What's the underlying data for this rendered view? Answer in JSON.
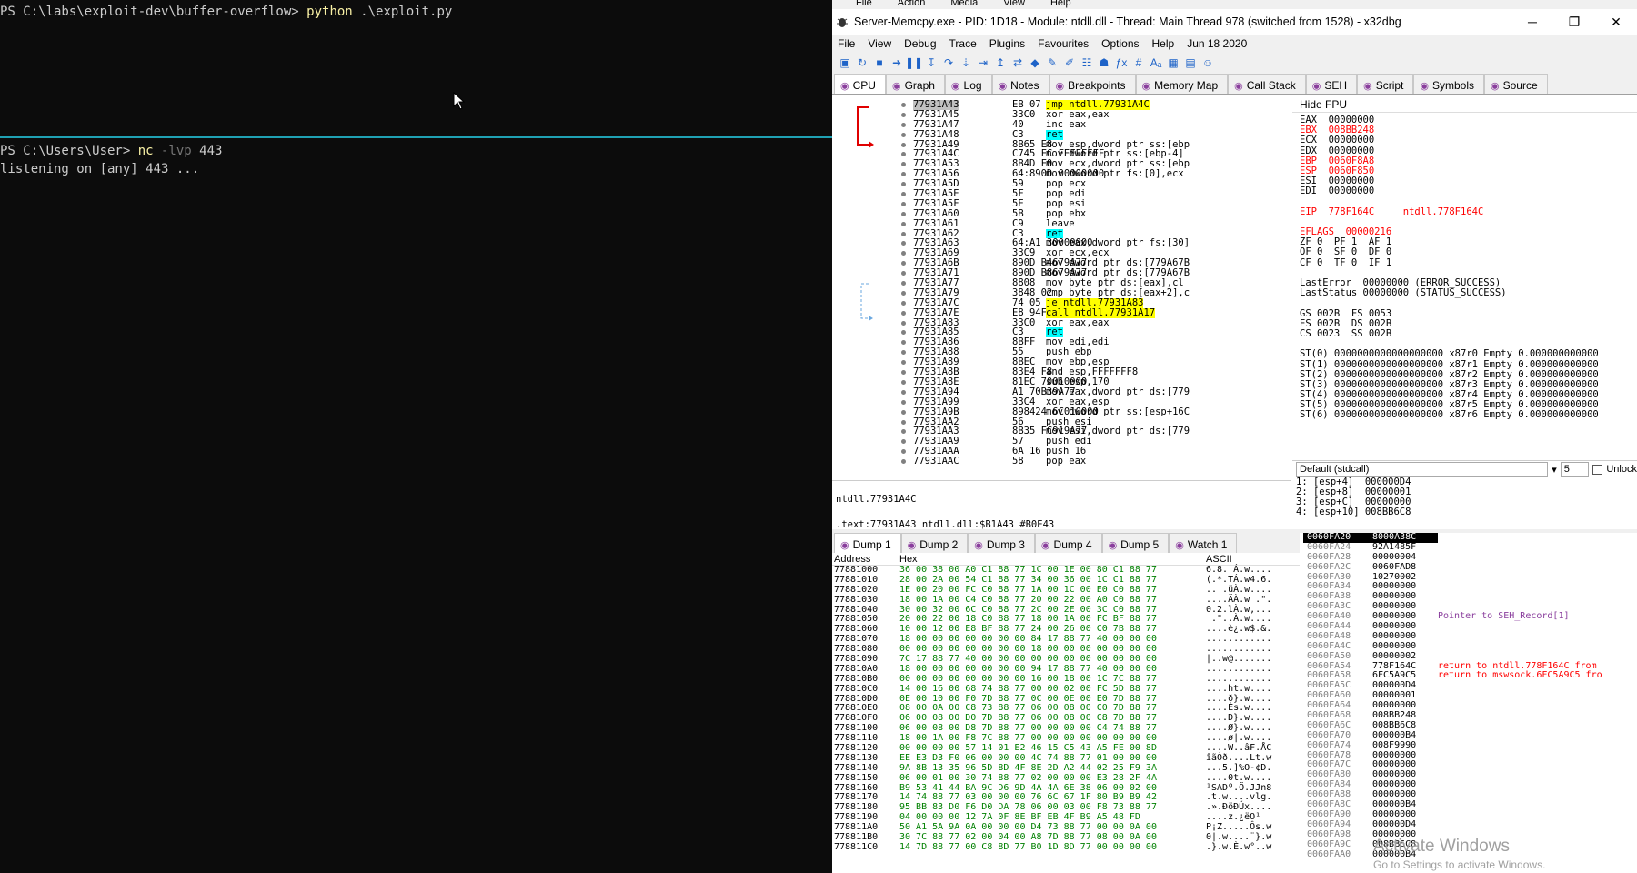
{
  "terminal": {
    "pane1": {
      "prompt": "PS C:\\labs\\exploit-dev\\buffer-overflow> ",
      "cmd": "python",
      "args": " .\\exploit.py"
    },
    "pane2": {
      "prompt": "PS C:\\Users\\User> ",
      "cmd": "nc",
      "flag": " -lvp",
      "args": " 443",
      "output": "listening on [any] 443 ..."
    },
    "divider_color": "#1fa1b3"
  },
  "xdbg": {
    "sysmenu": [
      "File",
      "Action",
      "Media",
      "View",
      "Help"
    ],
    "title": "Server-Memcpy.exe - PID: 1D18 - Module: ntdll.dll - Thread: Main Thread 978 (switched from 1528) - x32dbg",
    "menu": [
      "File",
      "View",
      "Debug",
      "Trace",
      "Plugins",
      "Favourites",
      "Options",
      "Help",
      "Jun 18 2020"
    ],
    "tabs": [
      "CPU",
      "Graph",
      "Log",
      "Notes",
      "Breakpoints",
      "Memory Map",
      "Call Stack",
      "SEH",
      "Script",
      "Symbols",
      "Source"
    ],
    "disasm": [
      {
        "addr": "77931A43",
        "bytes": "EB 07",
        "ins": "jmp ntdll.77931A4C",
        "hl": "y"
      },
      {
        "addr": "77931A45",
        "bytes": "33C0",
        "ins": "xor eax,eax"
      },
      {
        "addr": "77931A47",
        "bytes": "40",
        "ins": "inc eax"
      },
      {
        "addr": "77931A48",
        "bytes": "C3",
        "ins": "ret",
        "hl": "c"
      },
      {
        "addr": "77931A49",
        "bytes": "8B65 E8",
        "ins": "mov esp,dword ptr ss:[ebp"
      },
      {
        "addr": "77931A4C",
        "bytes": "C745 FC FEFFFFFF",
        "ins": "mov dword ptr ss:[ebp-4]"
      },
      {
        "addr": "77931A53",
        "bytes": "8B4D F0",
        "ins": "mov ecx,dword ptr ss:[ebp"
      },
      {
        "addr": "77931A56",
        "bytes": "64:890D 00000000",
        "ins": "mov dword ptr fs:[0],ecx"
      },
      {
        "addr": "77931A5D",
        "bytes": "59",
        "ins": "pop ecx"
      },
      {
        "addr": "77931A5E",
        "bytes": "5F",
        "ins": "pop edi"
      },
      {
        "addr": "77931A5F",
        "bytes": "5E",
        "ins": "pop esi"
      },
      {
        "addr": "77931A60",
        "bytes": "5B",
        "ins": "pop ebx"
      },
      {
        "addr": "77931A61",
        "bytes": "C9",
        "ins": "leave"
      },
      {
        "addr": "77931A62",
        "bytes": "C3",
        "ins": "ret",
        "hl": "c"
      },
      {
        "addr": "77931A63",
        "bytes": "64:A1 30000000",
        "ins": "mov eax,dword ptr fs:[30]"
      },
      {
        "addr": "77931A69",
        "bytes": "33C9",
        "ins": "xor ecx,ecx"
      },
      {
        "addr": "77931A6B",
        "bytes": "890D B4679A77",
        "ins": "mov dword ptr ds:[779A67B"
      },
      {
        "addr": "77931A71",
        "bytes": "890D B8679A77",
        "ins": "mov dword ptr ds:[779A67B"
      },
      {
        "addr": "77931A77",
        "bytes": "8808",
        "ins": "mov byte ptr ds:[eax],cl"
      },
      {
        "addr": "77931A79",
        "bytes": "3848 02",
        "ins": "cmp byte ptr ds:[eax+2],c"
      },
      {
        "addr": "77931A7C",
        "bytes": "74 05",
        "ins": "je ntdll.77931A83",
        "hl": "y"
      },
      {
        "addr": "77931A7E",
        "bytes": "E8 94FFFFFF",
        "ins": "call ntdll.77931A17",
        "hl": "y"
      },
      {
        "addr": "77931A83",
        "bytes": "33C0",
        "ins": "xor eax,eax"
      },
      {
        "addr": "77931A85",
        "bytes": "C3",
        "ins": "ret",
        "hl": "c"
      },
      {
        "addr": "77931A86",
        "bytes": "8BFF",
        "ins": "mov edi,edi"
      },
      {
        "addr": "77931A88",
        "bytes": "55",
        "ins": "push ebp"
      },
      {
        "addr": "77931A89",
        "bytes": "8BEC",
        "ins": "mov ebp,esp"
      },
      {
        "addr": "77931A8B",
        "bytes": "83E4 F8",
        "ins": "and esp,FFFFFFF8"
      },
      {
        "addr": "77931A8E",
        "bytes": "81EC 70010000",
        "ins": "sub esp,170"
      },
      {
        "addr": "77931A94",
        "bytes": "A1 70B39A77",
        "ins": "mov eax,dword ptr ds:[779"
      },
      {
        "addr": "77931A99",
        "bytes": "33C4",
        "ins": "xor eax,esp"
      },
      {
        "addr": "77931A9B",
        "bytes": "898424 6C010000",
        "ins": "mov dword ptr ss:[esp+16C"
      },
      {
        "addr": "77931AA2",
        "bytes": "56",
        "ins": "push esi"
      },
      {
        "addr": "77931AA3",
        "bytes": "8B35 FC919A77",
        "ins": "mov esi,dword ptr ds:[779"
      },
      {
        "addr": "77931AA9",
        "bytes": "57",
        "ins": "push edi"
      },
      {
        "addr": "77931AAA",
        "bytes": "6A 16",
        "ins": "push 16"
      },
      {
        "addr": "77931AAC",
        "bytes": "58",
        "ins": "pop eax"
      }
    ],
    "disasm_info": {
      "line1": "ntdll.77931A4C",
      "line2": ".text:77931A43 ntdll.dll:$B1A43 #B0E43"
    },
    "regs_header": "Hide FPU",
    "regs": [
      "EAX  00000000",
      "EBX  008BB248",
      "ECX  00000000",
      "EDX  00000000",
      "EBP  0060F8A8",
      "ESP  0060F850",
      "ESI  00000000",
      "EDI  00000000",
      "",
      "EIP  778F164C     ntdll.778F164C",
      "",
      "EFLAGS  00000216",
      "ZF 0  PF 1  AF 1",
      "OF 0  SF 0  DF 0",
      "CF 0  TF 0  IF 1",
      "",
      "LastError  00000000 (ERROR_SUCCESS)",
      "LastStatus 00000000 (STATUS_SUCCESS)",
      "",
      "GS 002B  FS 0053",
      "ES 002B  DS 002B",
      "CS 0023  SS 002B",
      "",
      "ST(0) 0000000000000000000 x87r0 Empty 0.000000000000",
      "ST(1) 0000000000000000000 x87r1 Empty 0.000000000000",
      "ST(2) 0000000000000000000 x87r2 Empty 0.000000000000",
      "ST(3) 0000000000000000000 x87r3 Empty 0.000000000000",
      "ST(4) 0000000000000000000 x87r4 Empty 0.000000000000",
      "ST(5) 0000000000000000000 x87r5 Empty 0.000000000000",
      "ST(6) 0000000000000000000 x87r6 Empty 0.000000000000"
    ],
    "callconv": {
      "select": "Default (stdcall)",
      "count": "5",
      "unlock": "Unlock",
      "rows": [
        "1: [esp+4]  000000D4",
        "2: [esp+8]  00000001",
        "3: [esp+C]  00000000",
        "4: [esp+10] 008BB6C8"
      ]
    },
    "dump_tabs": [
      "Dump 1",
      "Dump 2",
      "Dump 3",
      "Dump 4",
      "Dump 5",
      "Watch 1"
    ],
    "dump_headers": {
      "address": "Address",
      "hex": "Hex",
      "ascii": "ASCII"
    },
    "dump": [
      {
        "a": "77881000",
        "h": "36 00 38 00 A0 C1 88 77 1C 00 1E 00 80 C1 88 77",
        "s": "6.8. Á.w...."
      },
      {
        "a": "77881010",
        "h": "28 00 2A 00 54 C1 88 77 34 00 36 00 1C C1 88 77",
        "s": "(.*.TÁ.w4.6."
      },
      {
        "a": "77881020",
        "h": "1E 00 20 00 FC C0 88 77 1A 00 1C 00 E0 C0 88 77",
        "s": ".. .üÀ.w...."
      },
      {
        "a": "77881030",
        "h": "18 00 1A 00 C4 C0 88 77 20 00 22 00 A0 C0 88 77",
        "s": "....ÄÀ.w .\"."
      },
      {
        "a": "77881040",
        "h": "30 00 32 00 6C C0 88 77 2C 00 2E 00 3C C0 88 77",
        "s": "0.2.lÀ.w,..."
      },
      {
        "a": "77881050",
        "h": "20 00 22 00 18 C0 88 77 18 00 1A 00 FC BF 88 77",
        "s": " .\"..À.w...."
      },
      {
        "a": "77881060",
        "h": "10 00 12 00 E8 BF 88 77 24 00 26 00 C0 7B 88 77",
        "s": "....è¿.w$.&."
      },
      {
        "a": "77881070",
        "h": "18 00 00 00 00 00 00 00 84 17 88 77 40 00 00 00",
        "s": "............"
      },
      {
        "a": "77881080",
        "h": "00 00 00 00 00 00 00 00 18 00 00 00 00 00 00 00",
        "s": "............"
      },
      {
        "a": "77881090",
        "h": "7C 17 88 77 40 00 00 00 00 00 00 00 00 00 00 00",
        "s": "|..w@......."
      },
      {
        "a": "778810A0",
        "h": "18 00 00 00 00 00 00 00 94 17 88 77 40 00 00 00",
        "s": "............"
      },
      {
        "a": "778810B0",
        "h": "00 00 00 00 00 00 00 00 16 00 18 00 1C 7C 88 77",
        "s": "............"
      },
      {
        "a": "778810C0",
        "h": "14 00 16 00 68 74 88 77 00 00 02 00 FC 5D 88 77",
        "s": "....ht.w...."
      },
      {
        "a": "778810D0",
        "h": "0E 00 10 00 F0 7D 88 77 0C 00 0E 00 E0 7D 88 77",
        "s": "....ð}.w...."
      },
      {
        "a": "778810E0",
        "h": "08 00 0A 00 C8 73 88 77 06 00 08 00 C0 7D 88 77",
        "s": "....Ès.w...."
      },
      {
        "a": "778810F0",
        "h": "06 00 08 00 D0 7D 88 77 06 00 08 00 C8 7D 88 77",
        "s": "....Ð}.w...."
      },
      {
        "a": "77881100",
        "h": "06 00 08 00 D8 7D 88 77 00 00 00 00 C4 74 88 77",
        "s": "....Ø}.w...."
      },
      {
        "a": "77881110",
        "h": "18 00 1A 00 F8 7C 88 77 00 00 00 00 00 00 00 00",
        "s": "....ø|.w...."
      },
      {
        "a": "77881120",
        "h": "00 00 00 00 57 14 01 E2 46 15 C5 43 A5 FE 00 8D",
        "s": "....W..âF.ÅC"
      },
      {
        "a": "77881130",
        "h": "EE E3 D3 F0 06 00 00 00 4C 74 88 77 01 00 00 00",
        "s": "îãÓð....Lt.w"
      },
      {
        "a": "77881140",
        "h": "9A 8B 13 35 96 5D 8D 4F 8E 2D A2 44 02 25 F9 3A",
        "s": "...5.]%O-¢D."
      },
      {
        "a": "77881150",
        "h": "06 00 01 00 30 74 88 77 02 00 00 00 E3 28 2F 4A",
        "s": "....0t.w...."
      },
      {
        "a": "77881160",
        "h": "B9 53 41 44 BA 9C D6 9D 4A 4A 6E 38 06 00 02 00",
        "s": "¹SADº.Ö.JJn8"
      },
      {
        "a": "77881170",
        "h": "14 74 88 77 03 00 00 00 76 6C 67 1F 80 B9 B9 42",
        "s": ".t.w....vlg."
      },
      {
        "a": "77881180",
        "h": "95 BB 83 D0 F6 D0 DA 78 06 00 03 00 F8 73 88 77",
        "s": ".».ÐöÐÚx...."
      },
      {
        "a": "77881190",
        "h": "04 00 00 00 12 7A 0F 8E BF EB 4F B9 A5 48 FD",
        "s": "....z.¿ëO¹"
      },
      {
        "a": "778811A0",
        "h": "50 A1 5A 9A 0A 00 00 00 D4 73 88 77 00 00 0A 00",
        "s": "P¡Z.....Ôs.w"
      },
      {
        "a": "778811B0",
        "h": "30 7C 88 77 02 00 04 00 A8 7D 88 77 08 00 0A 00",
        "s": "0|.w....¨}.w"
      },
      {
        "a": "778811C0",
        "h": "14 7D 88 77 00 C8 8D 77 B0 1D 8D 77 00 00 00 00",
        "s": ".}.w.È.w°..w"
      }
    ],
    "stack": [
      {
        "a": "0060FA20",
        "v": "8000A38C",
        "c": ""
      },
      {
        "a": "0060FA24",
        "v": "92A1485F",
        "c": ""
      },
      {
        "a": "0060FA28",
        "v": "00000004",
        "c": ""
      },
      {
        "a": "0060FA2C",
        "v": "0060FAD8",
        "c": ""
      },
      {
        "a": "0060FA30",
        "v": "10270002",
        "c": ""
      },
      {
        "a": "0060FA34",
        "v": "00000000",
        "c": ""
      },
      {
        "a": "0060FA38",
        "v": "00000000",
        "c": ""
      },
      {
        "a": "0060FA3C",
        "v": "00000000",
        "c": ""
      },
      {
        "a": "0060FA40",
        "v": "00000000",
        "c": "Pointer to SEH_Record[1]",
        "cls": "p"
      },
      {
        "a": "0060FA44",
        "v": "00000000",
        "c": ""
      },
      {
        "a": "0060FA48",
        "v": "00000000",
        "c": ""
      },
      {
        "a": "0060FA4C",
        "v": "00000000",
        "c": ""
      },
      {
        "a": "0060FA50",
        "v": "00000002",
        "c": ""
      },
      {
        "a": "0060FA54",
        "v": "778F164C",
        "c": "return to ntdll.778F164C from"
      },
      {
        "a": "0060FA58",
        "v": "6FC5A9C5",
        "c": "return to mswsock.6FC5A9C5 fro"
      },
      {
        "a": "0060FA5C",
        "v": "000000D4",
        "c": ""
      },
      {
        "a": "0060FA60",
        "v": "00000001",
        "c": ""
      },
      {
        "a": "0060FA64",
        "v": "00000000",
        "c": ""
      },
      {
        "a": "0060FA68",
        "v": "008BB248",
        "c": ""
      },
      {
        "a": "0060FA6C",
        "v": "008BB6C8",
        "c": ""
      },
      {
        "a": "0060FA70",
        "v": "000000B4",
        "c": ""
      },
      {
        "a": "0060FA74",
        "v": "008F9990",
        "c": ""
      },
      {
        "a": "0060FA78",
        "v": "00000000",
        "c": ""
      },
      {
        "a": "0060FA7C",
        "v": "00000000",
        "c": ""
      },
      {
        "a": "0060FA80",
        "v": "00000000",
        "c": ""
      },
      {
        "a": "0060FA84",
        "v": "00000000",
        "c": ""
      },
      {
        "a": "0060FA88",
        "v": "00000000",
        "c": ""
      },
      {
        "a": "0060FA8C",
        "v": "000000B4",
        "c": ""
      },
      {
        "a": "0060FA90",
        "v": "00000000",
        "c": ""
      },
      {
        "a": "0060FA94",
        "v": "000000D4",
        "c": ""
      },
      {
        "a": "0060FA98",
        "v": "00000000",
        "c": ""
      },
      {
        "a": "0060FA9C",
        "v": "008BB6C8",
        "c": ""
      },
      {
        "a": "0060FAA0",
        "v": "000000B4",
        "c": ""
      }
    ]
  },
  "watermark": {
    "line1": "Activate Windows",
    "line2": "Go to Settings to activate Windows."
  }
}
